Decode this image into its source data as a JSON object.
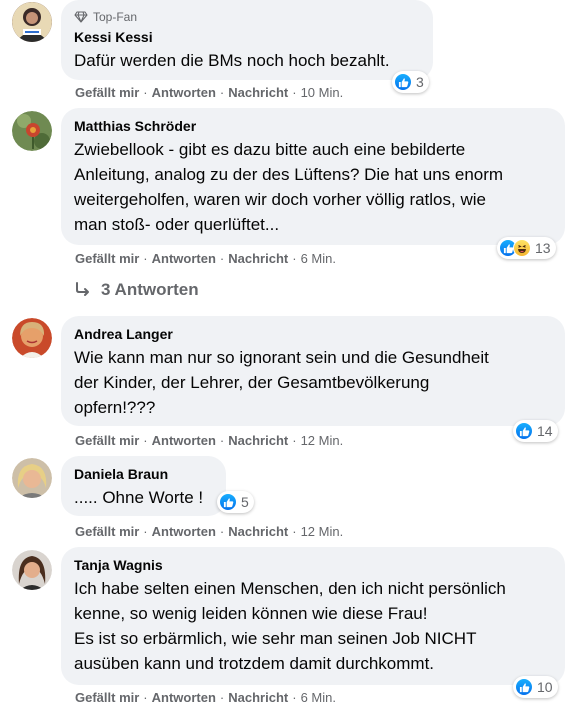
{
  "labels": {
    "like": "Gefällt mir",
    "reply": "Antworten",
    "message": "Nachricht",
    "dot": "·"
  },
  "comments": [
    {
      "badge": "Top-Fan",
      "author": "Kessi Kessi",
      "text": [
        "Dafür werden die BMs noch hoch bezahlt."
      ],
      "reactions": {
        "types": [
          "like"
        ],
        "count": "3"
      },
      "time": "10 Min."
    },
    {
      "author": "Matthias Schröder",
      "text": [
        "Zwiebellook - gibt es dazu bitte auch eine bebilderte",
        "Anleitung, analog zu der des Lüftens? Die hat uns enorm",
        "weitergeholfen, waren wir doch vorher völlig ratlos, wie",
        "man stoß- oder querlüftet..."
      ],
      "reactions": {
        "types": [
          "like",
          "haha"
        ],
        "count": "13"
      },
      "time": "6 Min.",
      "replies": "3 Antworten"
    },
    {
      "author": "Andrea Langer",
      "text": [
        "Wie kann man nur so ignorant sein und die Gesundheit",
        "der Kinder, der Lehrer, der Gesamtbevölkerung",
        "opfern!???"
      ],
      "reactions": {
        "types": [
          "like"
        ],
        "count": "14"
      },
      "time": "12 Min."
    },
    {
      "author": "Daniela Braun",
      "text": [
        "..... Ohne Worte !"
      ],
      "reactions": {
        "types": [
          "like"
        ],
        "count": "5"
      },
      "time": "12 Min."
    },
    {
      "author": "Tanja Wagnis",
      "text": [
        "Ich habe selten einen Menschen, den ich nicht persönlich",
        "kenne, so wenig leiden können wie diese Frau!",
        "Es ist so erbärmlich, wie sehr man seinen Job NICHT",
        "ausüben kann und trotzdem damit durchkommt."
      ],
      "reactions": {
        "types": [
          "like"
        ],
        "count": "10"
      },
      "time": "6 Min."
    }
  ],
  "colors": {
    "bubble": "#f0f2f5",
    "meta": "#65676b",
    "text": "#050505",
    "like": "#0571ed"
  }
}
